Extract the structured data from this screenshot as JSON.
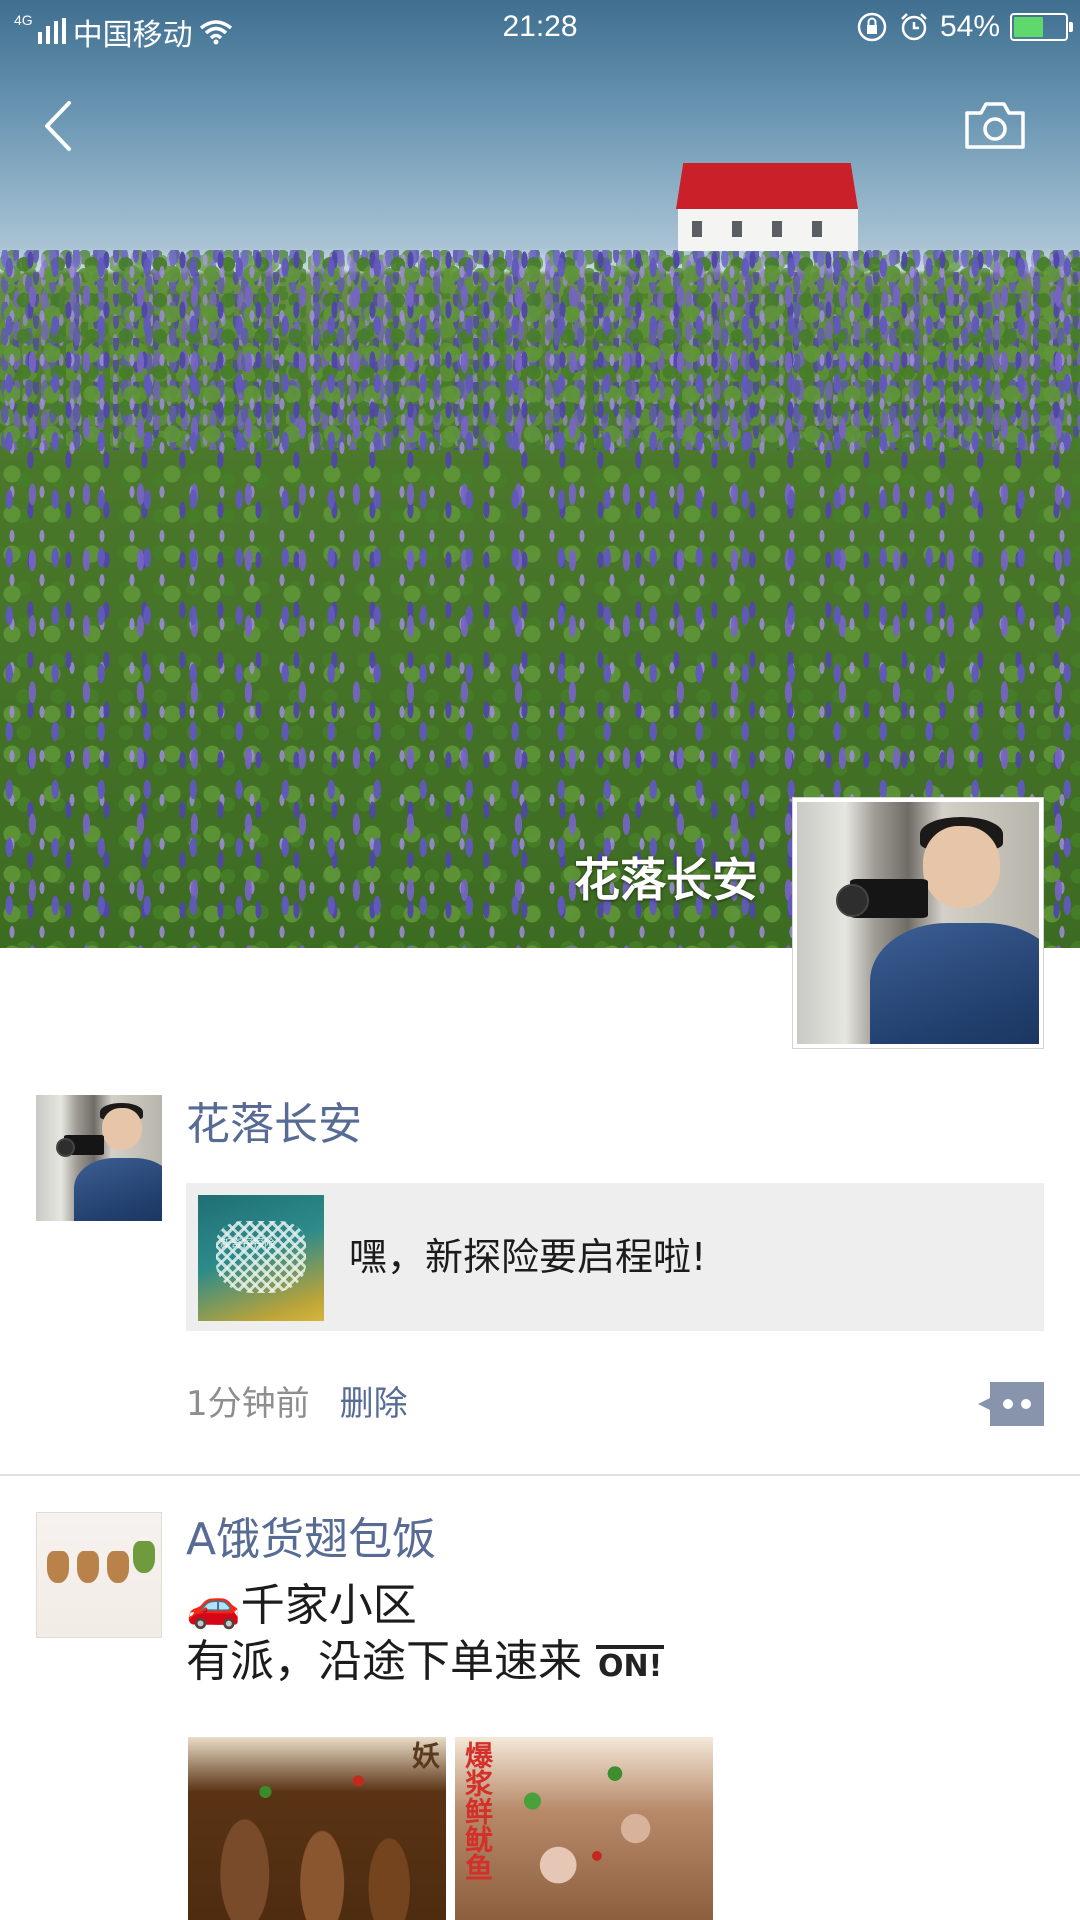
{
  "status_bar": {
    "network_tag": "4G",
    "carrier": "中国移动",
    "time": "21:28",
    "battery": "54%",
    "battery_level": 0.54,
    "icons": [
      "signal-icon",
      "wifi-icon",
      "rotation-lock-icon",
      "alarm-icon",
      "battery-icon"
    ]
  },
  "header": {
    "back_icon": "back-icon",
    "camera_icon": "camera-icon"
  },
  "profile": {
    "name": "花落长安"
  },
  "posts": [
    {
      "username": "花落长安",
      "share": {
        "text": "嘿，新探险要启程啦!",
        "thumb_text": "新奇探探险"
      },
      "time": "1分钟前",
      "delete_label": "删除",
      "more_icon": "comment-more-icon"
    },
    {
      "username": "A饿货翅包饭",
      "lines": [
        {
          "emoji": "🚗",
          "text": "千家小区"
        },
        {
          "text": "有派，沿途下单速来",
          "emoji_after": "ON!"
        }
      ],
      "images": [
        {
          "label": "妖"
        },
        {
          "label": "爆浆鲜鱿鱼"
        }
      ]
    }
  ],
  "colors": {
    "link": "#576b95",
    "text": "#1c1c1c",
    "muted": "#8e8e8e",
    "card_bg": "#eeeeee"
  }
}
